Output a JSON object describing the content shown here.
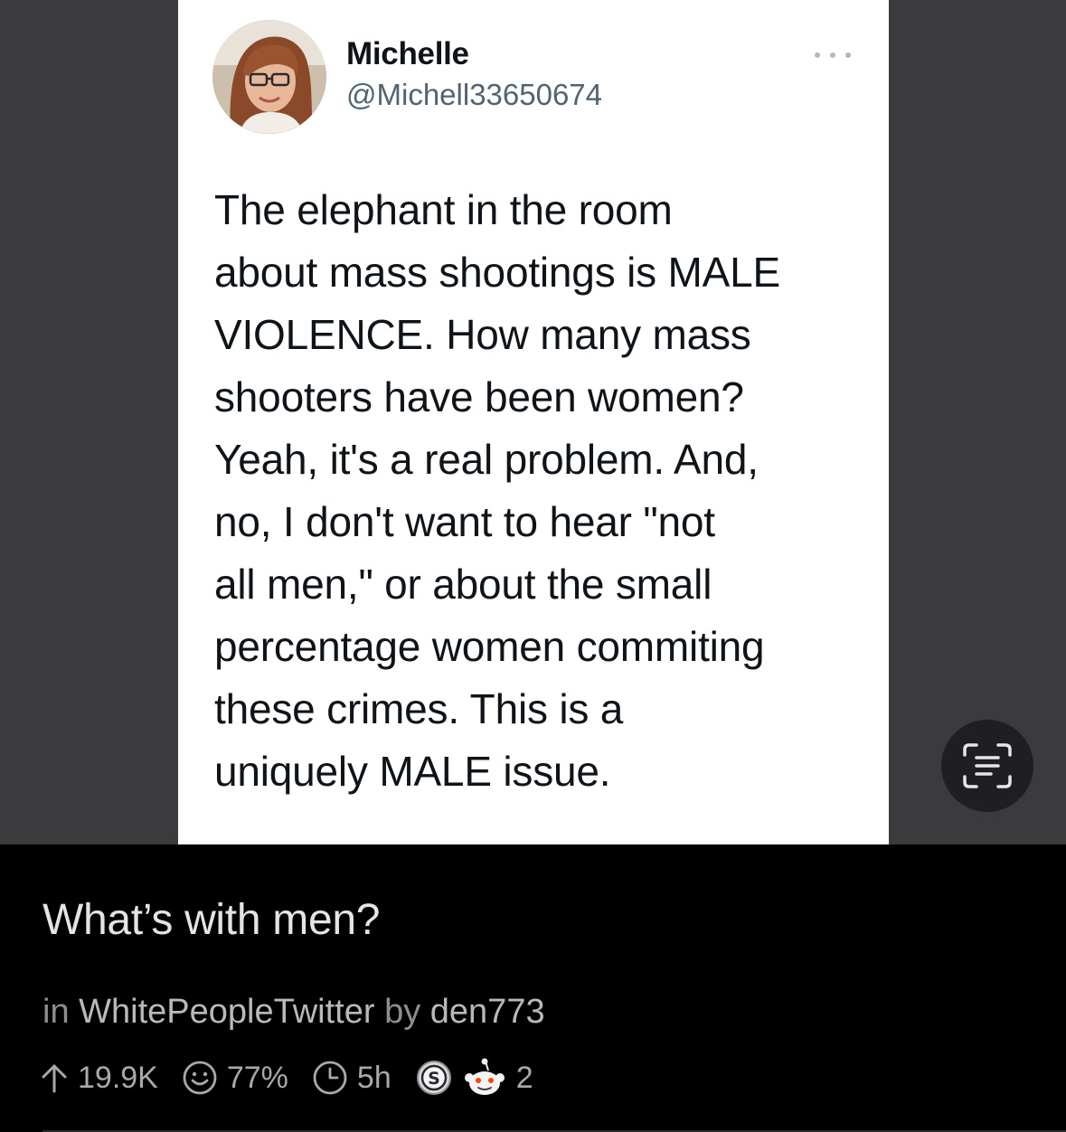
{
  "tweet": {
    "display_name": "Michelle",
    "handle": "@Michell33650674",
    "text": "The elephant in the room\nabout mass shootings is MALE\nVIOLENCE.  How many mass\nshooters have been women?\nYeah, it's a real problem.  And,\nno, I don't want to hear \"not\nall men,\" or about the small\npercentage women commiting\nthese crimes.  This is a\nuniquely MALE issue."
  },
  "post": {
    "title": "What’s with men?",
    "in_label": "in",
    "subreddit": "WhitePeopleTwitter",
    "by_label": "by",
    "author": "den773",
    "upvotes": "19.9K",
    "upvote_ratio": "77%",
    "age": "5h",
    "awards_count": "2"
  },
  "icons": {
    "more": "more-horizontal-icon",
    "scan": "live-text-scan-icon",
    "upvote": "arrow-up-icon",
    "ratio": "smiley-face-icon",
    "age": "clock-icon",
    "award_1": "silver-s-award-icon",
    "award_2": "reddit-snoo-award-icon"
  },
  "colors": {
    "background": "#000000",
    "media_background": "#3b3b3d",
    "tweet_background": "#ffffff",
    "title_text": "#e4e4e6",
    "meta_text": "#8d8d92"
  }
}
